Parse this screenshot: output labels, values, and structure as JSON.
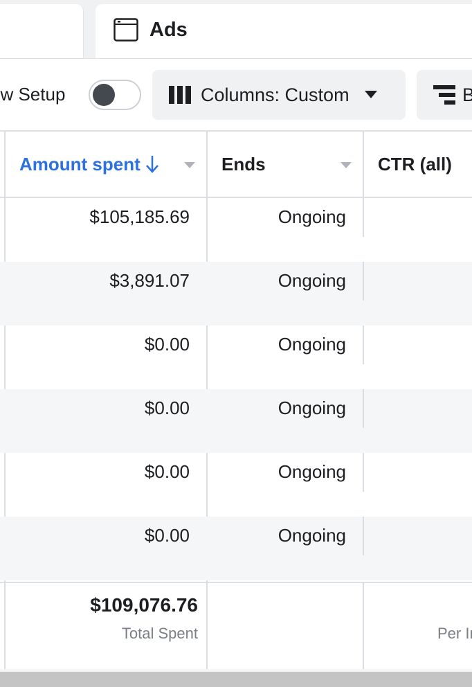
{
  "tabs": {
    "ads_label": "Ads"
  },
  "toolbar": {
    "review_setup_label": "ew Setup",
    "review_setup_on": false,
    "columns_label": "Columns: Custom",
    "breakdown_label": "B"
  },
  "table": {
    "headers": {
      "amount_spent": "Amount spent",
      "ends": "Ends",
      "ctr": "CTR (all)"
    },
    "sort_column": "amount_spent",
    "sort_direction": "descending",
    "rows": [
      {
        "amount_spent": "$105,185.69",
        "ends": "Ongoing"
      },
      {
        "amount_spent": "$3,891.07",
        "ends": "Ongoing"
      },
      {
        "amount_spent": "$0.00",
        "ends": "Ongoing"
      },
      {
        "amount_spent": "$0.00",
        "ends": "Ongoing"
      },
      {
        "amount_spent": "$0.00",
        "ends": "Ongoing"
      },
      {
        "amount_spent": "$0.00",
        "ends": "Ongoing"
      }
    ],
    "summary": {
      "total_value": "$109,076.76",
      "total_label": "Total Spent",
      "per_label": "Per In"
    }
  },
  "colors": {
    "accent": "#2d70e0",
    "alt_row": "#f5f6f7",
    "muted_text": "#7a7f86"
  }
}
